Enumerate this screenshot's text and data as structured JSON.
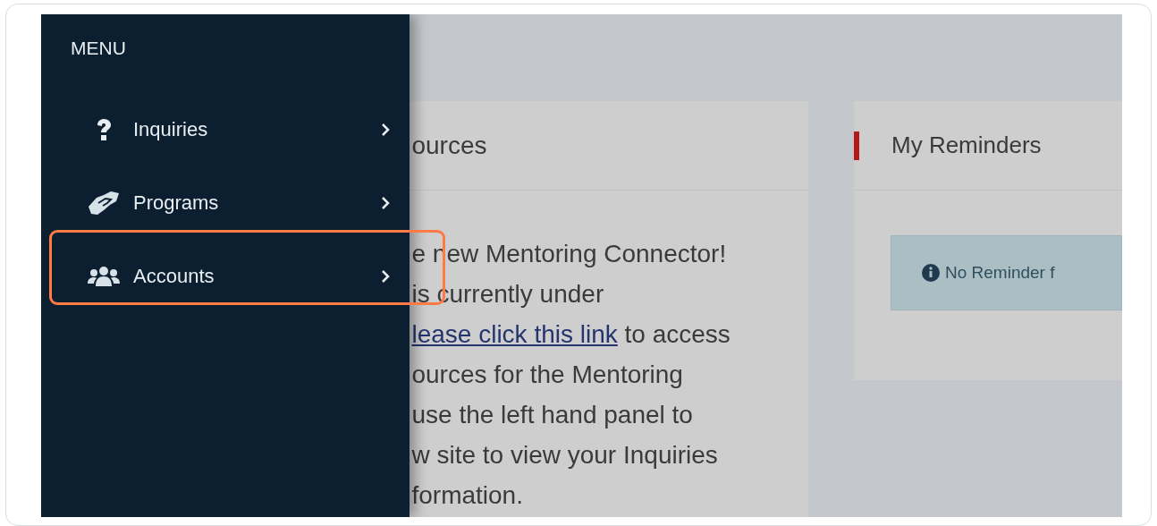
{
  "menu": {
    "title": "MENU",
    "items": [
      {
        "label": "Inquiries",
        "highlighted": false
      },
      {
        "label": "Programs",
        "highlighted": false
      },
      {
        "label": "Accounts",
        "highlighted": true
      }
    ]
  },
  "resources_card": {
    "title": "ources",
    "lines": [
      {
        "text": "e new Mentoring Connector!"
      },
      {
        "text": "is currently under"
      },
      {
        "link": "lease click this link",
        "text": " to access"
      },
      {
        "text": "ources for the Mentoring"
      },
      {
        "text": "use the left hand panel to"
      },
      {
        "text": "w site to view your Inquiries"
      },
      {
        "text": "formation."
      }
    ]
  },
  "reminders_card": {
    "title": "My Reminders",
    "alert": "No Reminder f"
  }
}
